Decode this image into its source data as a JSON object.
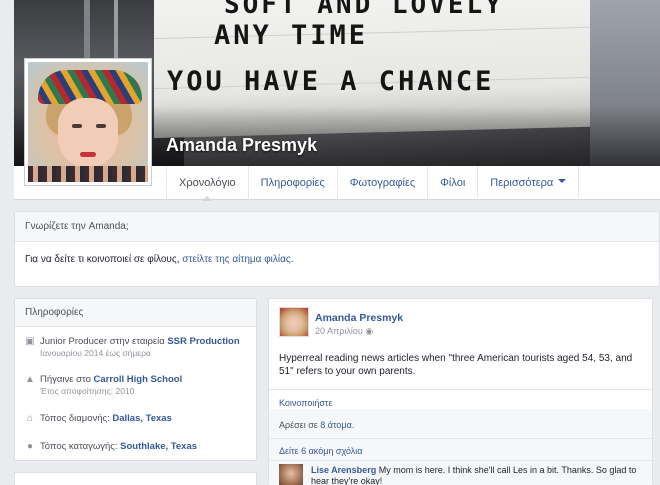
{
  "cover": {
    "marquee_line1": "SOFT AND LOVELY",
    "marquee_line2": "ANY TIME",
    "marquee_line3": "YOU HAVE A CHANCE",
    "profile_name": "Amanda Presmyk"
  },
  "nav": {
    "tabs": [
      {
        "label": "Χρονολόγιο"
      },
      {
        "label": "Πληροφορίες"
      },
      {
        "label": "Φωτογραφίες"
      },
      {
        "label": "Φίλοι"
      },
      {
        "label": "Περισσότερα"
      }
    ]
  },
  "know": {
    "title": "Γνωρίζετε την Amanda;",
    "text_before": "Για να δείτε τι κοινοποιεί σε φίλους, ",
    "link": "στείλτε της αίτημα φιλίας",
    "text_after": "."
  },
  "info": {
    "title": "Πληροφορίες",
    "work_prefix": "Junior Producer στην εταιρεία ",
    "work_company": "SSR Production",
    "work_dates": "Ιανουαρίου 2014 έως σήμερα",
    "school_prefix": "Πήγαινε στο ",
    "school_name": "Carroll High School",
    "school_grad": "Έτος αποφοίτησης: 2010",
    "lives_prefix": "Τόπος διαμονής: ",
    "lives_city": "Dallas, Texas",
    "from_prefix": "Τόπος καταγωγής: ",
    "from_city": "Southlake, Texas"
  },
  "post": {
    "author": "Amanda Presmyk",
    "date": "20 Απριλίου",
    "text": "Hyperreal reading news articles when \"three American tourists aged 54, 53, and 51\" refers to your own parents.",
    "share": "Κοινοποιήστε",
    "likes_prefix": "Αρέσει σε ",
    "likes_link": "8 άτομα",
    "likes_suffix": ".",
    "more_comments": "Δείτε 6 ακόμη σχόλια",
    "comment_author": "Lise Arensberg",
    "comment_text": " My mom is here. I think she'll call Les in a bit. Thanks. So glad to hear they're okay!"
  },
  "icons": {
    "work": "briefcase-icon",
    "school": "graduation-cap-icon",
    "lives": "home-icon",
    "from": "location-pin-icon",
    "privacy": "globe-icon"
  },
  "colors": {
    "link": "#365899",
    "background": "#e9ebee",
    "cover_dark": "#2b2b2e"
  }
}
